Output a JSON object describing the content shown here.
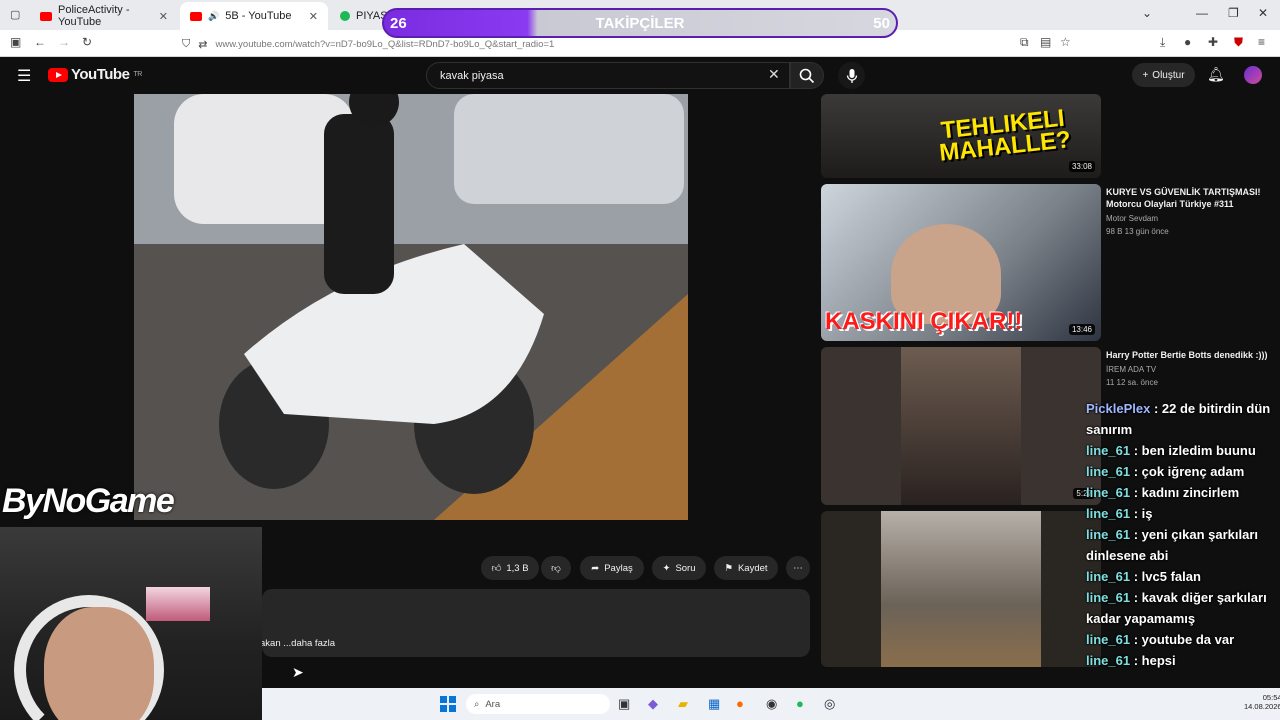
{
  "browser": {
    "tabs": [
      {
        "label": "PoliceActivity - YouTube"
      },
      {
        "label": "5B - YouTube"
      },
      {
        "label": "PIYASA"
      }
    ],
    "url": "www.youtube.com/watch?v=nD7-bo9Lo_Q&list=RDnD7-bo9Lo_Q&start_radio=1"
  },
  "youtube": {
    "logo": "YouTube",
    "logo_sup": "TR",
    "search_value": "kavak piyasa",
    "create_label": "Oluştur"
  },
  "actions": {
    "like_count": "1,3 B",
    "share": "Paylaş",
    "ask": "Soru",
    "save": "Kaydet"
  },
  "description": {
    "text": "akan ...daha fazla"
  },
  "sidebar": {
    "items": [
      {
        "overlay_text": "TEHLIKELI MAHALLE?",
        "duration": "33:08"
      },
      {
        "overlay_text": "KASKINI ÇIKAR!!",
        "duration": "13:46",
        "title": "KURYE VS GÜVENLİK TARTIŞMASI! Motorcu Olaylari Türkiye #311",
        "channel": "Motor Sevdam",
        "meta": "98 B  13 gün önce"
      },
      {
        "duration": "5:27",
        "title": "Harry Potter Bertie Botts denedikk :)))",
        "channel": "İREM ADA TV",
        "meta": "11  12 sa. önce"
      },
      {}
    ]
  },
  "overlay": {
    "followers_label": "TAKİPÇİLER",
    "followers_current": "26",
    "followers_goal": "50",
    "brand": "ByNoGame"
  },
  "chat": [
    {
      "user": "PicklePlex",
      "msg": "22 de bitirdin dün sanırım"
    },
    {
      "user": "line_61",
      "msg": "ben izledim buunu"
    },
    {
      "user": "line_61",
      "msg": "çok iğrenç adam"
    },
    {
      "user": "line_61",
      "msg": "kadını zincirlem"
    },
    {
      "user": "line_61",
      "msg": "iş"
    },
    {
      "user": "line_61",
      "msg": "yeni çıkan şarkıları dinlesene abi"
    },
    {
      "user": "line_61",
      "msg": "lvc5 falan"
    },
    {
      "user": "line_61",
      "msg": "kavak diğer şarkıları kadar yapamamış"
    },
    {
      "user": "line_61",
      "msg": "youtube da var"
    },
    {
      "user": "line_61",
      "msg": "hepsi"
    }
  ],
  "taskbar": {
    "search_placeholder": "Ara",
    "time": "05:54",
    "date": "14.08.2026"
  },
  "colors": {
    "yt_red": "#ff0000",
    "chat_user": "#7fdfe0",
    "follow_bar": "#8a3af0"
  }
}
